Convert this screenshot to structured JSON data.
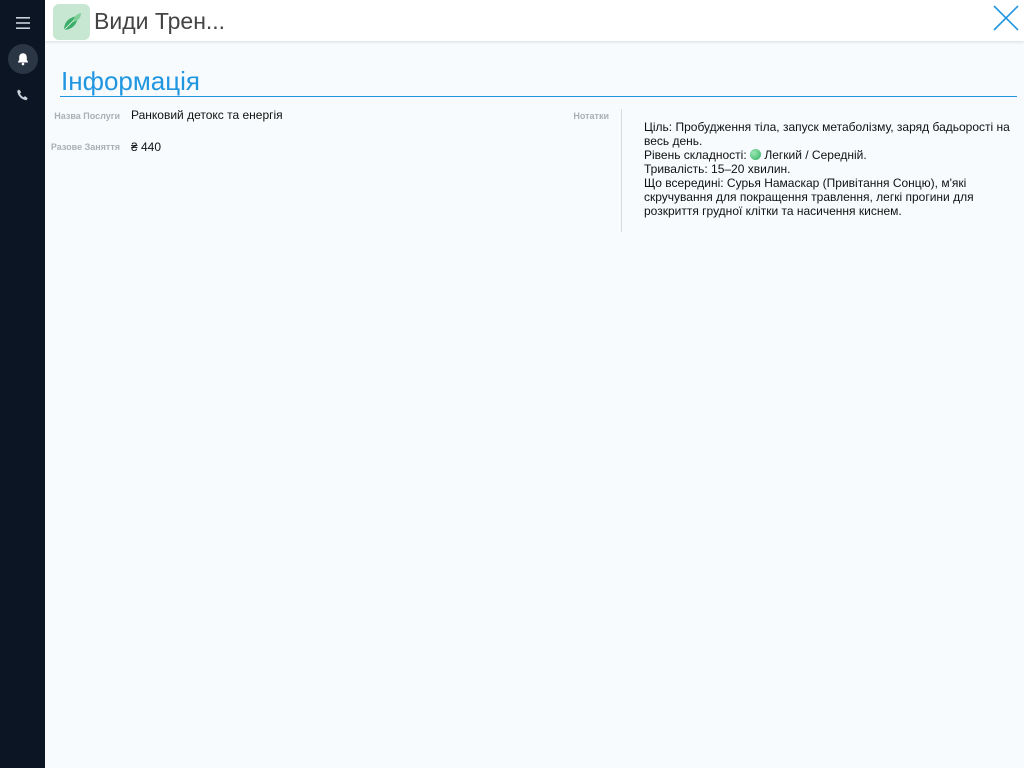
{
  "header": {
    "title": "Види Трен..."
  },
  "sidebar": {
    "items": [
      {
        "icon": "menu-icon"
      },
      {
        "icon": "bell-icon"
      },
      {
        "icon": "phone-icon"
      }
    ]
  },
  "section": {
    "title": "Інформація"
  },
  "fields": {
    "name_label": "Назва Послуги",
    "name_value": "Ранковий детокс та енергія",
    "price_label": "Разове Заняття",
    "price_value": "₴ 440",
    "notes_label": "Нотатки"
  },
  "notes": {
    "line1": "Ціль: Пробудження тіла, запуск метаболізму, заряд бадьорості на весь день.",
    "line2_prefix": "Рівень складності:",
    "line2_suffix": "Легкий / Середній.",
    "line3": "Тривалість: 15–20 хвилин.",
    "line4": "Що всередині: Сурья Намаскар (Привітання Сонцю), м'які скручування для покращення травлення, легкі прогини для розкриття грудної клітки та насичення киснем."
  },
  "colors": {
    "accent": "#2196e0",
    "sidebar": "#0b1524",
    "logo_bg": "#c8e7d3",
    "leaf": "#3cae6a",
    "level_dot": "#2fae5e"
  }
}
